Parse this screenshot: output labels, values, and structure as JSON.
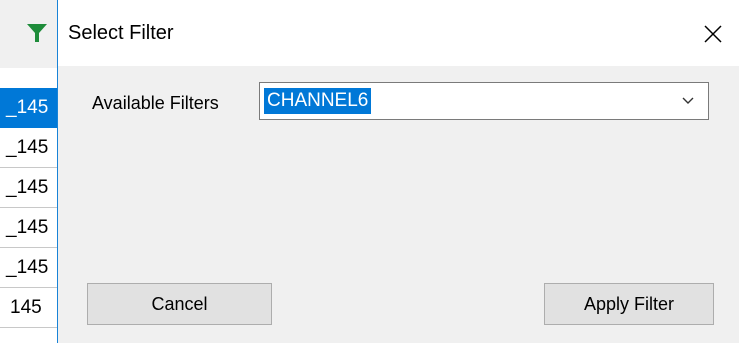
{
  "background": {
    "rows": [
      {
        "text": "_145",
        "selected": true
      },
      {
        "text": "_145",
        "selected": false
      },
      {
        "text": "_145",
        "selected": false
      },
      {
        "text": "_145",
        "selected": false
      },
      {
        "text": "_145",
        "selected": false
      },
      {
        "text": "145",
        "selected": false
      }
    ],
    "icon": "filter-icon",
    "icon_color": "#1e8c3a"
  },
  "dialog": {
    "title": "Select Filter",
    "close_icon": "close-icon",
    "filters_label": "Available Filters",
    "filter_select": {
      "selected_value": "CHANNEL6"
    },
    "cancel_label": "Cancel",
    "apply_label": "Apply Filter"
  },
  "colors": {
    "accent": "#0078d7",
    "dialog_bg": "#f0f0f0",
    "button_bg": "#e1e1e1"
  }
}
